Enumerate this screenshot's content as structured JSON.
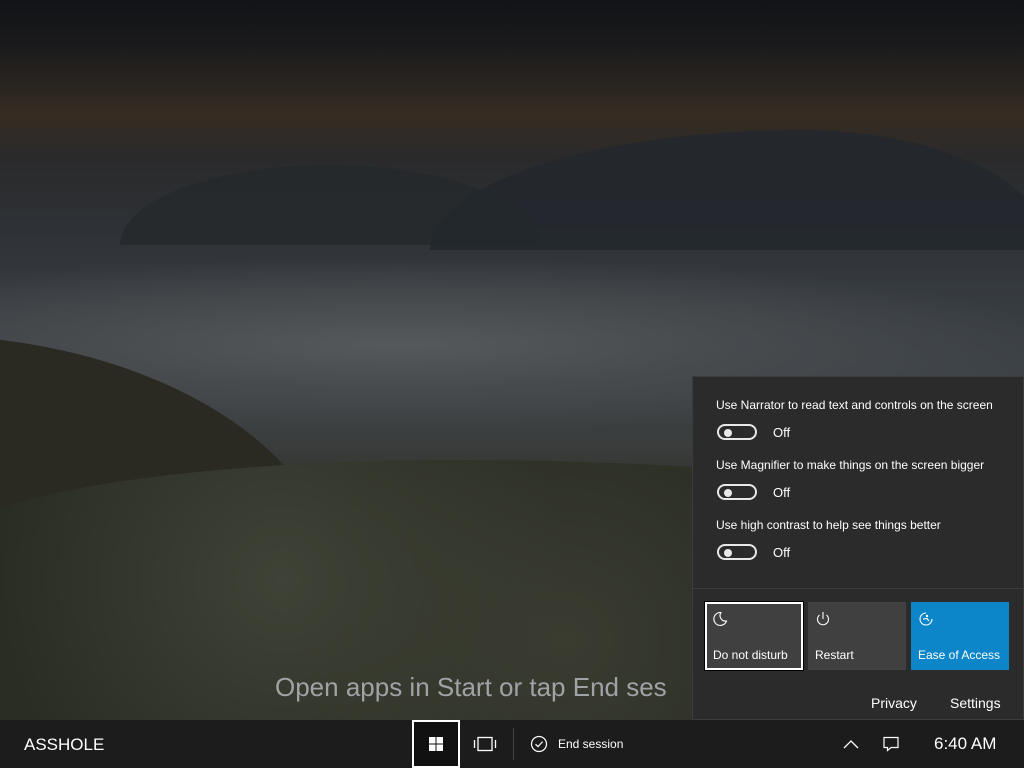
{
  "background": {
    "hint_text": "Open apps in Start or tap End ses"
  },
  "flyout": {
    "options": [
      {
        "label": "Use Narrator to read text and controls on the screen",
        "state": "Off"
      },
      {
        "label": "Use Magnifier to make things on the screen bigger",
        "state": "Off"
      },
      {
        "label": "Use high contrast to help see things better",
        "state": "Off"
      }
    ],
    "tiles": [
      {
        "label": "Do not disturb",
        "icon": "moon-icon"
      },
      {
        "label": "Restart",
        "icon": "power-icon"
      },
      {
        "label": "Ease of Access",
        "icon": "ease-of-access-icon",
        "color": "#0d86c9"
      }
    ],
    "links": {
      "privacy": "Privacy",
      "settings": "Settings"
    }
  },
  "taskbar": {
    "user_name": "ASSHOLE",
    "end_session_label": "End session",
    "clock": "6:40 AM",
    "icons": [
      "windows-start-icon",
      "task-view-icon",
      "checkmark-circle-icon",
      "chevron-up-icon",
      "action-center-icon"
    ]
  }
}
